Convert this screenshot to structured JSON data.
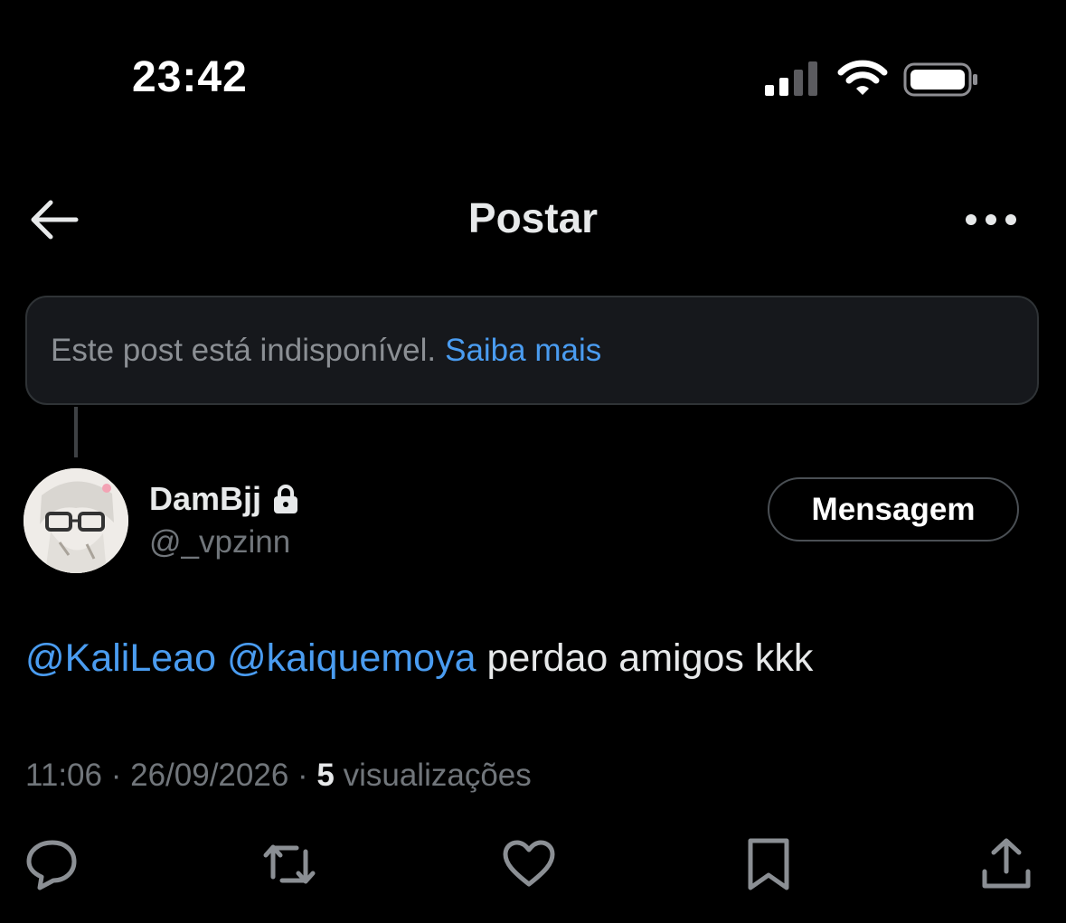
{
  "status_bar": {
    "time": "23:42"
  },
  "header": {
    "title": "Postar"
  },
  "notice": {
    "text": "Este post está indisponível.",
    "link": "Saiba mais"
  },
  "author": {
    "name": "DamBjj",
    "handle": "@_vpzinn",
    "message_button": "Mensagem"
  },
  "post": {
    "mentions": [
      "@KaliLeao",
      "@kaiquemoya"
    ],
    "text": "perdao amigos kkk",
    "time": "11:06",
    "date": "26/09/2026",
    "views_count": "5",
    "views_label": "visualizações"
  },
  "colors": {
    "background": "#000000",
    "link": "#4a9cf0",
    "muted": "#71767b",
    "text": "#e7e9ea"
  },
  "icons": [
    "signal-icon",
    "wifi-icon",
    "battery-icon",
    "back-arrow-icon",
    "more-icon",
    "lock-icon",
    "reply-icon",
    "repost-icon",
    "like-icon",
    "bookmark-icon",
    "share-icon"
  ]
}
